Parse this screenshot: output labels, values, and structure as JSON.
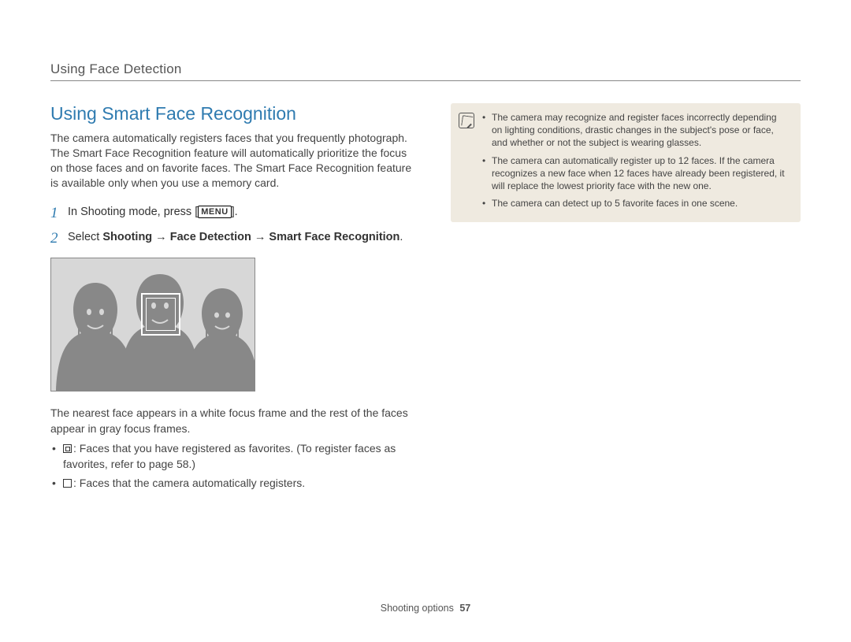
{
  "header": {
    "breadcrumb": "Using Face Detection"
  },
  "section": {
    "title": "Using Smart Face Recognition",
    "intro": "The camera automatically registers faces that you frequently photograph. The Smart Face Recognition feature will automatically prioritize the focus on those faces and on favorite faces. The Smart Face Recognition feature is available only when you use a memory card."
  },
  "steps": {
    "s1": {
      "num": "1",
      "prefix": "In Shooting mode, press [",
      "menu": "MENU",
      "suffix": "]."
    },
    "s2": {
      "num": "2",
      "prefix": "Select ",
      "path": "Shooting → Face Detection → Smart Face Recognition",
      "suffix": "."
    }
  },
  "legend": {
    "intro": "The nearest face appears in a white focus frame and the rest of the faces appear in gray focus frames.",
    "item1": ": Faces that you have registered as favorites. (To register faces as favorites, refer to page 58.)",
    "item2": ": Faces that the camera automatically registers."
  },
  "notes": {
    "n1": "The camera may recognize and register faces incorrectly depending on lighting conditions, drastic changes in the subject's pose or face, and whether or not the subject is wearing glasses.",
    "n2": "The camera can automatically register up to 12 faces. If the camera recognizes a new face when 12 faces have already been registered, it will replace the lowest priority face with the new one.",
    "n3": "The camera can detect up to 5 favorite faces in one scene."
  },
  "footer": {
    "section": "Shooting options",
    "page": "57"
  }
}
